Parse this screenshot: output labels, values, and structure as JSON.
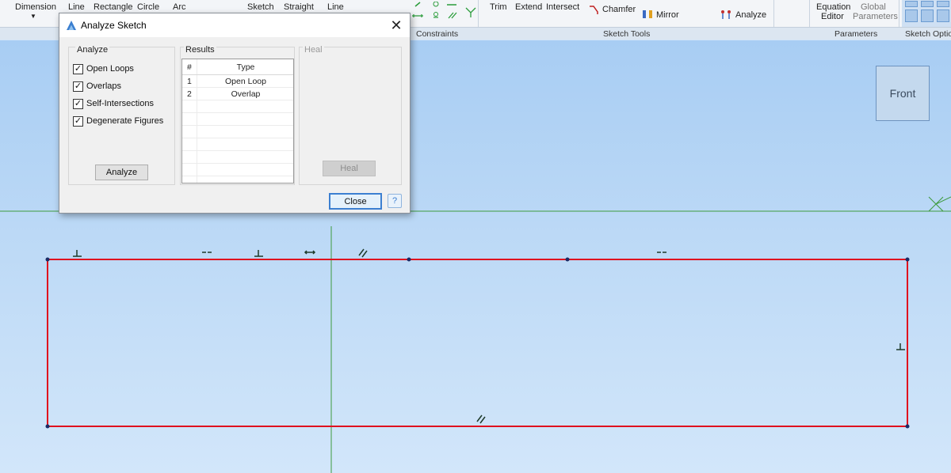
{
  "ribbon": {
    "tools": {
      "dimension": "Dimension",
      "line": "Line",
      "rectangle": "Rectangle",
      "circle": "Circle",
      "arc": "Arc",
      "sketch": "Sketch",
      "straight": "Straight",
      "line2": "Line",
      "trim": "Trim",
      "extend": "Extend",
      "intersect": "Intersect",
      "chamfer": "Chamfer",
      "mirror": "Mirror",
      "analyze": "Analyze",
      "equation_editor_1": "Equation",
      "equation_editor_2": "Editor",
      "global_parameters_1": "Global",
      "global_parameters_2": "Parameters"
    },
    "groups": {
      "constraints": "Constraints",
      "sketch_tools": "Sketch Tools",
      "parameters": "Parameters",
      "sketch_options": "Sketch Optio..."
    }
  },
  "view_cube": {
    "face": "Front"
  },
  "dialog": {
    "title": "Analyze Sketch",
    "analyze_section": {
      "title": "Analyze",
      "options": [
        {
          "label": "Open Loops",
          "checked": true
        },
        {
          "label": "Overlaps",
          "checked": true
        },
        {
          "label": "Self-Intersections",
          "checked": true
        },
        {
          "label": "Degenerate Figures",
          "checked": true
        }
      ],
      "analyze_button": "Analyze"
    },
    "results_section": {
      "title": "Results",
      "columns": [
        "#",
        "Type"
      ],
      "rows": [
        {
          "num": "1",
          "type": "Open Loop"
        },
        {
          "num": "2",
          "type": "Overlap"
        }
      ]
    },
    "heal_section": {
      "title": "Heal",
      "heal_button": "Heal"
    },
    "close_button": "Close",
    "help_button": "?"
  },
  "colors": {
    "sketch_line": "#e0101e",
    "axis_line": "#3d9a3d",
    "constraint_glyph": "#1d3a2a",
    "vertex": "#1a2b66",
    "accent": "#3c7fd1"
  }
}
